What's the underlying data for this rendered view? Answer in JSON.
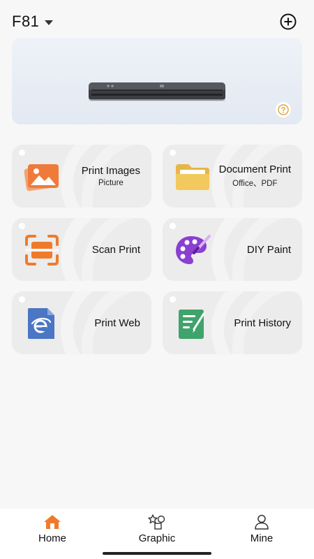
{
  "header": {
    "device_name": "F81"
  },
  "banner": {
    "help_icon": "question-circle-icon"
  },
  "features": [
    {
      "title": "Print Images",
      "subtitle": "Picture",
      "icon": "image-icon"
    },
    {
      "title": "Document Print",
      "subtitle": "Office、PDF",
      "icon": "folder-icon"
    },
    {
      "title": "Scan Print",
      "icon": "scan-icon"
    },
    {
      "title": "DIY Paint",
      "icon": "palette-icon"
    },
    {
      "title": "Print Web",
      "icon": "browser-icon"
    },
    {
      "title": "Print History",
      "icon": "history-icon"
    }
  ],
  "nav": {
    "items": [
      {
        "label": "Home",
        "icon": "home-icon",
        "active": true
      },
      {
        "label": "Graphic",
        "icon": "shapes-icon",
        "active": false
      },
      {
        "label": "Mine",
        "icon": "person-icon",
        "active": false
      }
    ]
  },
  "colors": {
    "accent": "#f07a2b",
    "card_bg": "#ececec"
  }
}
